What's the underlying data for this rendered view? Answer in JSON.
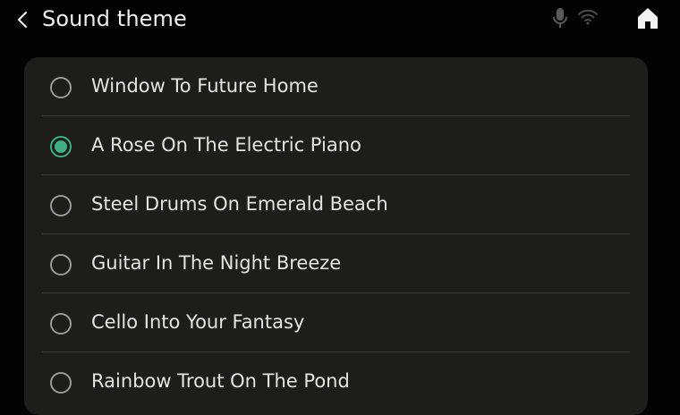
{
  "header": {
    "title": "Sound theme"
  },
  "icons": {
    "back": "chevron-left",
    "mic": "microphone",
    "wifi": "wifi",
    "home": "home"
  },
  "colors": {
    "background": "#030303",
    "panel": "#1d1d1b",
    "accent": "#3fae84"
  },
  "sound_themes": {
    "selected_index": 1,
    "items": [
      {
        "label": "Window To Future Home",
        "selected": false
      },
      {
        "label": "A Rose On The Electric Piano",
        "selected": true
      },
      {
        "label": "Steel Drums On Emerald Beach",
        "selected": false
      },
      {
        "label": "Guitar In The Night Breeze",
        "selected": false
      },
      {
        "label": "Cello Into Your Fantasy",
        "selected": false
      },
      {
        "label": "Rainbow Trout On The Pond",
        "selected": false
      }
    ]
  }
}
